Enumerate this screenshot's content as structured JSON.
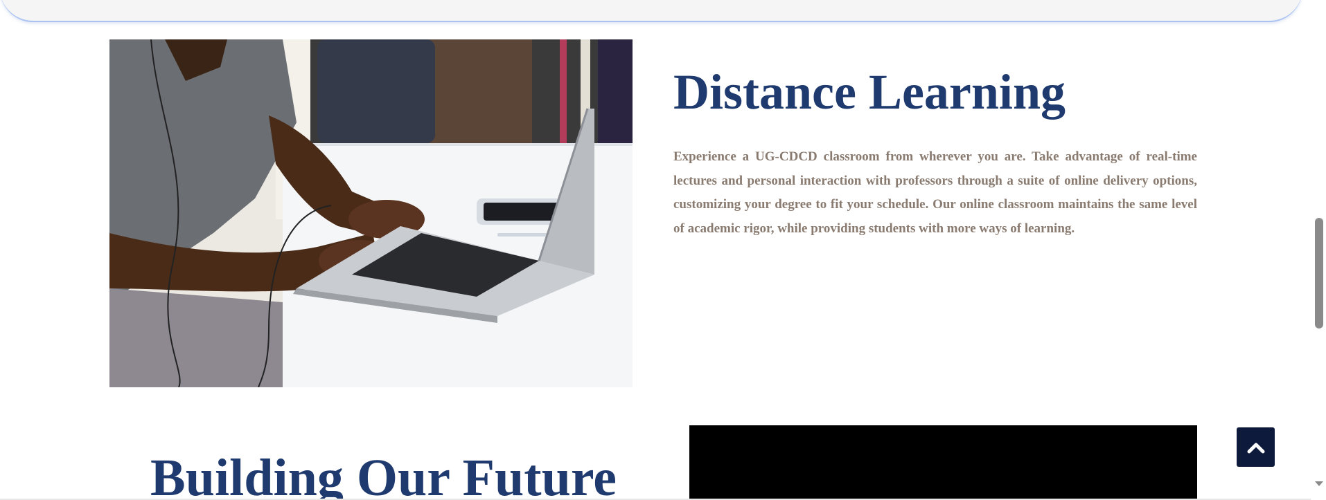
{
  "distance_learning": {
    "title": "Distance Learning",
    "description": "Experience a UG-CDCD classroom from wherever you are. Take advantage of real-time lectures and personal interaction with professors through a suite of online delivery options, customizing your degree to fit your schedule. Our online classroom maintains the same level of academic rigor, while providing students with more ways of learning."
  },
  "future": {
    "title": "Building Our Future"
  },
  "icons": {
    "back_to_top": "chevron-up-icon"
  },
  "colors": {
    "heading": "#1f3a6e",
    "body_text": "#8a7b70",
    "back_to_top_bg": "#0d1a3c"
  }
}
